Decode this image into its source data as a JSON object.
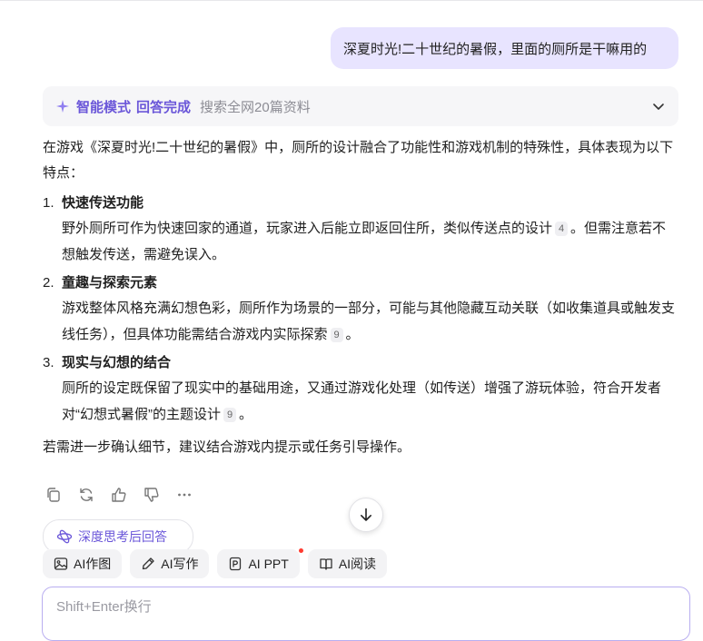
{
  "user_message": "深夏时光!二十世纪的暑假，里面的厕所是干嘛用的",
  "mode_bar": {
    "mode": "智能模式",
    "status": "回答完成",
    "sources": "搜索全网20篇资料"
  },
  "answer": {
    "intro": "在游戏《深夏时光!二十世纪的暑假》中，厕所的设计融合了功能性和游戏机制的特殊性，具体表现为以下特点：",
    "items": [
      {
        "num": "1.",
        "title": "快速传送功能",
        "body": "野外厕所可作为快速回家的通道，玩家进入后能立即返回住所，类似传送点的设计",
        "cite": "4",
        "body_after": "。但需注意若不想触发传送，需避免误入。"
      },
      {
        "num": "2.",
        "title": "童趣与探索元素",
        "body": "游戏整体风格充满幻想色彩，厕所作为场景的一部分，可能与其他隐藏互动关联（如收集道具或触发支线任务），但具体功能需结合游戏内实际探索",
        "cite": "9",
        "body_after": "。"
      },
      {
        "num": "3.",
        "title": "现实与幻想的结合",
        "body": "厕所的设定既保留了现实中的基础用途，又通过游戏化处理（如传送）增强了游玩体验，符合开发者对“幻想式暑假”的主题设计",
        "cite": "9",
        "body_after": "。"
      }
    ],
    "closing": "若需进一步确认细节，建议结合游戏内提示或任务引导操作。"
  },
  "action_icons": [
    "copy-icon",
    "regenerate-icon",
    "thumbs-up-icon",
    "thumbs-down-icon",
    "more-icon"
  ],
  "deep_think_button": "深度思考后回答",
  "toolbar": [
    {
      "label": "AI作图",
      "icon": "image-icon"
    },
    {
      "label": "AI写作",
      "icon": "pen-icon"
    },
    {
      "label": "AI PPT",
      "icon": "ppt-icon",
      "badge": true
    },
    {
      "label": "AI阅读",
      "icon": "book-icon"
    }
  ],
  "input": {
    "placeholder": "Shift+Enter换行"
  },
  "colors": {
    "accent": "#6b57d9",
    "user_bubble": "#e8e4ff",
    "badge": "#ff3b30"
  }
}
